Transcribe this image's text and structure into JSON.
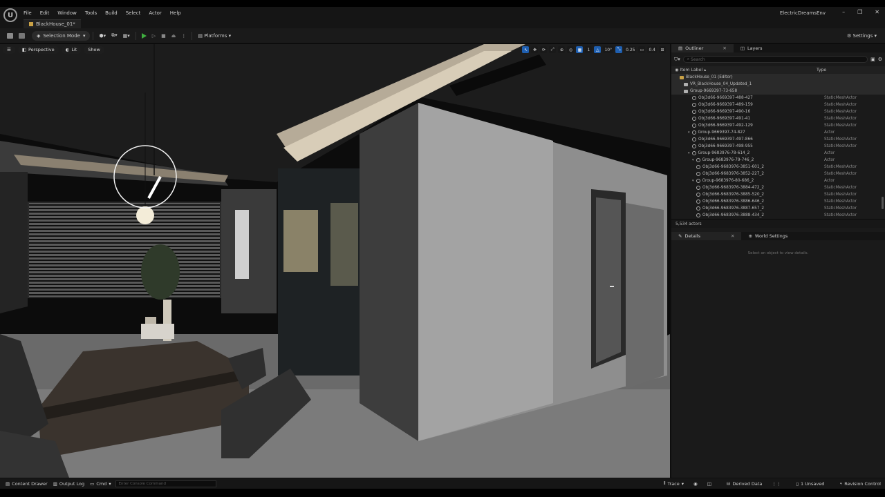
{
  "menubar": {
    "items": [
      "File",
      "Edit",
      "Window",
      "Tools",
      "Build",
      "Select",
      "Actor",
      "Help"
    ],
    "project": "ElectricDreamsEnv"
  },
  "level_tab": "BlackHouse_01*",
  "toolbar": {
    "selection_mode": "Selection Mode",
    "platforms": "Platforms",
    "settings": "Settings"
  },
  "viewport": {
    "perspective": "Perspective",
    "lit": "Lit",
    "show": "Show",
    "grid_snap": "1",
    "rotation_snap": "10°",
    "scale_snap": "0.25",
    "camera_speed": "0.4"
  },
  "outliner": {
    "tab_outliner": "Outliner",
    "tab_layers": "Layers",
    "search_placeholder": "Search",
    "col_label": "Item Label ▴",
    "col_type": "Type",
    "rows": [
      {
        "indent": 2,
        "label": "BlackHouse_01 (Editor)",
        "type": "",
        "icon": "map",
        "hl": true
      },
      {
        "indent": 3,
        "label": "VR_BlackHouse_04_Updated_1",
        "type": "",
        "icon": "folder",
        "hl": true
      },
      {
        "indent": 3,
        "label": "Group-9669397-73-658",
        "type": "",
        "icon": "folder",
        "hl": true
      },
      {
        "indent": 5,
        "label": "Obj3d66-9669397-488-427",
        "type": "StaticMeshActor",
        "icon": "mesh",
        "hl": false
      },
      {
        "indent": 5,
        "label": "Obj3d66-9669397-489-159",
        "type": "StaticMeshActor",
        "icon": "mesh",
        "hl": false
      },
      {
        "indent": 5,
        "label": "Obj3d66-9669397-490-16",
        "type": "StaticMeshActor",
        "icon": "mesh",
        "hl": false
      },
      {
        "indent": 5,
        "label": "Obj3d66-9669397-491-41",
        "type": "StaticMeshActor",
        "icon": "mesh",
        "hl": false
      },
      {
        "indent": 5,
        "label": "Obj3d66-9669397-492-129",
        "type": "StaticMeshActor",
        "icon": "mesh",
        "hl": false
      },
      {
        "indent": 4,
        "label": "Group-9669397-74-827",
        "type": "Actor",
        "icon": "group",
        "hl": false
      },
      {
        "indent": 5,
        "label": "Obj3d66-9669397-497-866",
        "type": "StaticMeshActor",
        "icon": "mesh",
        "hl": false
      },
      {
        "indent": 5,
        "label": "Obj3d66-9669397-498-955",
        "type": "StaticMeshActor",
        "icon": "mesh",
        "hl": false
      },
      {
        "indent": 4,
        "label": "Group-9683976-78-614_2",
        "type": "Actor",
        "icon": "group",
        "hl": false
      },
      {
        "indent": 5,
        "label": "Group-9683976-79-746_2",
        "type": "Actor",
        "icon": "group",
        "hl": false
      },
      {
        "indent": 6,
        "label": "Obj3d66-9683976-3851-601_2",
        "type": "StaticMeshActor",
        "icon": "mesh",
        "hl": false
      },
      {
        "indent": 6,
        "label": "Obj3d66-9683976-3852-227_2",
        "type": "StaticMeshActor",
        "icon": "mesh",
        "hl": false
      },
      {
        "indent": 5,
        "label": "Group-9683976-80-686_2",
        "type": "Actor",
        "icon": "group",
        "hl": false
      },
      {
        "indent": 6,
        "label": "Obj3d66-9683976-3884-472_2",
        "type": "StaticMeshActor",
        "icon": "mesh",
        "hl": false
      },
      {
        "indent": 6,
        "label": "Obj3d66-9683976-3885-520_2",
        "type": "StaticMeshActor",
        "icon": "mesh",
        "hl": false
      },
      {
        "indent": 6,
        "label": "Obj3d66-9683976-3886-646_2",
        "type": "StaticMeshActor",
        "icon": "mesh",
        "hl": false
      },
      {
        "indent": 6,
        "label": "Obj3d66-9683976-3887-657_2",
        "type": "StaticMeshActor",
        "icon": "mesh",
        "hl": false
      },
      {
        "indent": 6,
        "label": "Obj3d66-9683976-3888-434_2",
        "type": "StaticMeshActor",
        "icon": "mesh",
        "hl": false
      }
    ],
    "actor_count": "5,534 actors"
  },
  "details": {
    "tab_details": "Details",
    "tab_world": "World Settings",
    "hint": "Select an object to view details."
  },
  "statusbar": {
    "content_drawer": "Content Drawer",
    "output_log": "Output Log",
    "cmd": "Cmd",
    "console_placeholder": "Enter Console Command",
    "trace": "Trace",
    "derived_data": "Derived Data",
    "unsaved": "1 Unsaved",
    "revision": "Revision Control"
  }
}
